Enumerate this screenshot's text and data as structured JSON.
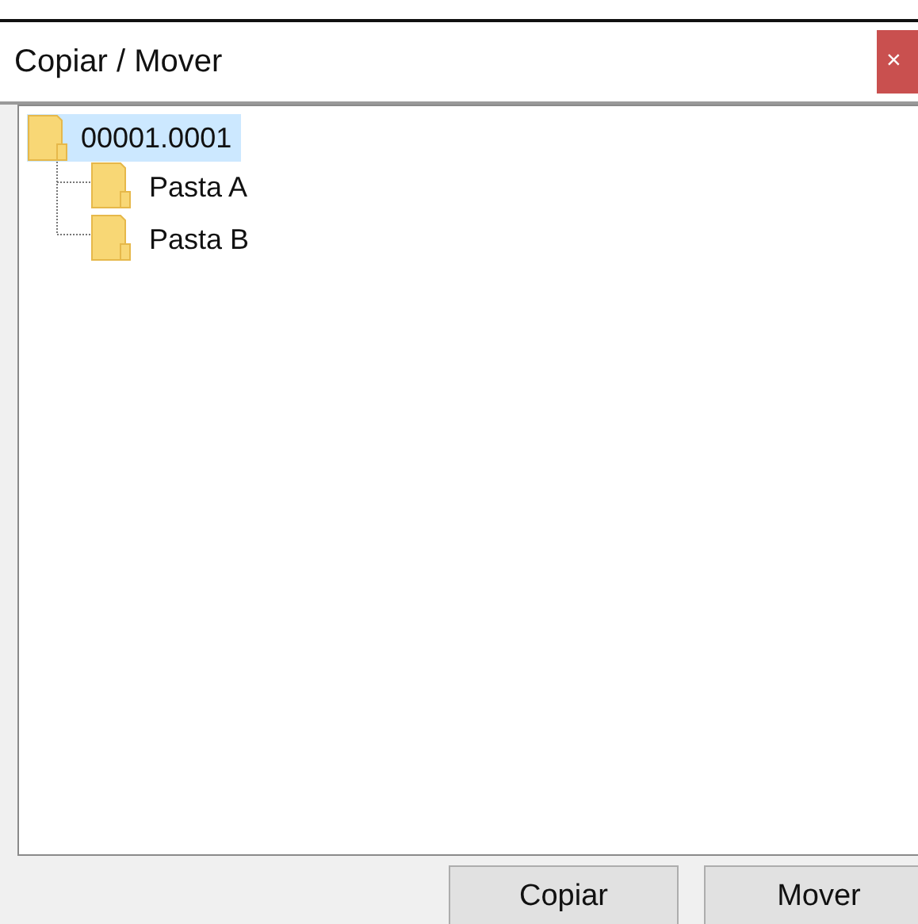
{
  "window": {
    "title": "Copiar / Mover",
    "close": "×"
  },
  "tree": [
    {
      "label": "00001.0001",
      "selected": true,
      "children": [
        {
          "label": "Pasta A",
          "selected": false
        },
        {
          "label": "Pasta B",
          "selected": false
        }
      ]
    }
  ],
  "buttons": [
    "Copiar",
    "Mover"
  ]
}
